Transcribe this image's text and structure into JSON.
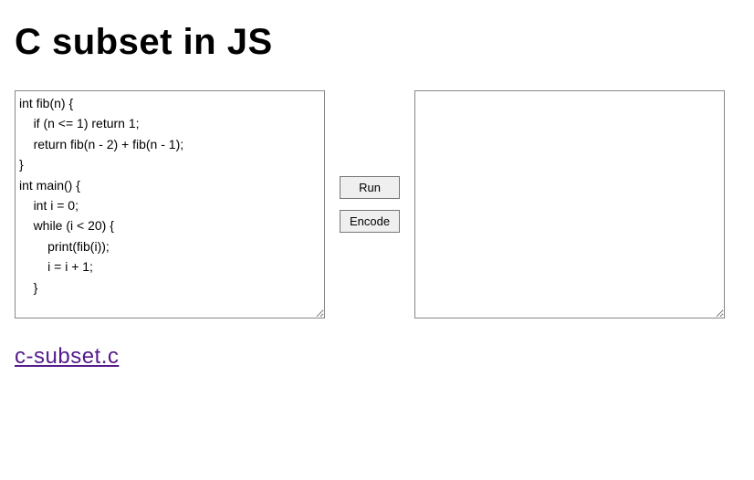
{
  "title": "C subset in JS",
  "editor": {
    "source_code": "int fib(n) {\n    if (n <= 1) return 1;\n    return fib(n - 2) + fib(n - 1);\n}\nint main() {\n    int i = 0;\n    while (i < 20) {\n        print(fib(i));\n        i = i + 1;\n    }\n",
    "output": ""
  },
  "buttons": {
    "run_label": "Run",
    "encode_label": "Encode"
  },
  "link": {
    "text": "c-subset.c"
  }
}
